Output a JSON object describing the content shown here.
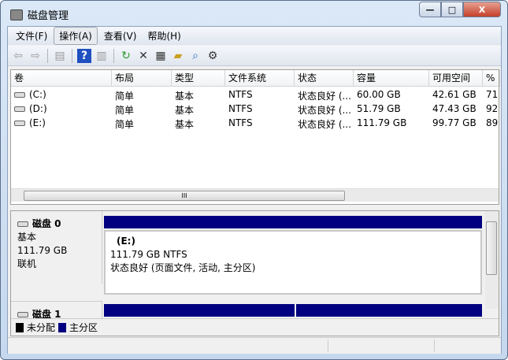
{
  "window": {
    "title": "磁盘管理",
    "min": "—",
    "max": "□",
    "close": "X"
  },
  "menu": [
    "文件(F)",
    "操作(A)",
    "查看(V)",
    "帮助(H)"
  ],
  "toolbar": {
    "icons": [
      "back-icon",
      "forward-icon",
      "show-console-tree-icon",
      "help-icon",
      "show-action-pane-icon",
      "refresh-icon",
      "delete-icon",
      "properties-icon",
      "open-icon",
      "explore-icon",
      "settings-icon"
    ]
  },
  "table": {
    "columns": [
      "卷",
      "布局",
      "类型",
      "文件系统",
      "状态",
      "容量",
      "可用空间",
      "%"
    ],
    "rows": [
      [
        "(C:)",
        "简单",
        "基本",
        "NTFS",
        "状态良好 (...",
        "60.00 GB",
        "42.61 GB",
        "71"
      ],
      [
        "(D:)",
        "简单",
        "基本",
        "NTFS",
        "状态良好 (...",
        "51.79 GB",
        "47.43 GB",
        "92"
      ],
      [
        "(E:)",
        "简单",
        "基本",
        "NTFS",
        "状态良好 (...",
        "111.79 GB",
        "99.77 GB",
        "89"
      ]
    ]
  },
  "scroll_grip": "III",
  "disks": [
    {
      "name": "磁盘 0",
      "type": "基本",
      "size": "111.79 GB",
      "state": "联机",
      "partition": {
        "label": "(E:)",
        "size": "111.79 GB NTFS",
        "status": "状态良好 (页面文件, 活动, 主分区)"
      }
    },
    {
      "name": "磁盘 1"
    }
  ],
  "legend": [
    {
      "label": "未分配",
      "color": "#000000"
    },
    {
      "label": "主分区",
      "color": "#000080"
    }
  ]
}
